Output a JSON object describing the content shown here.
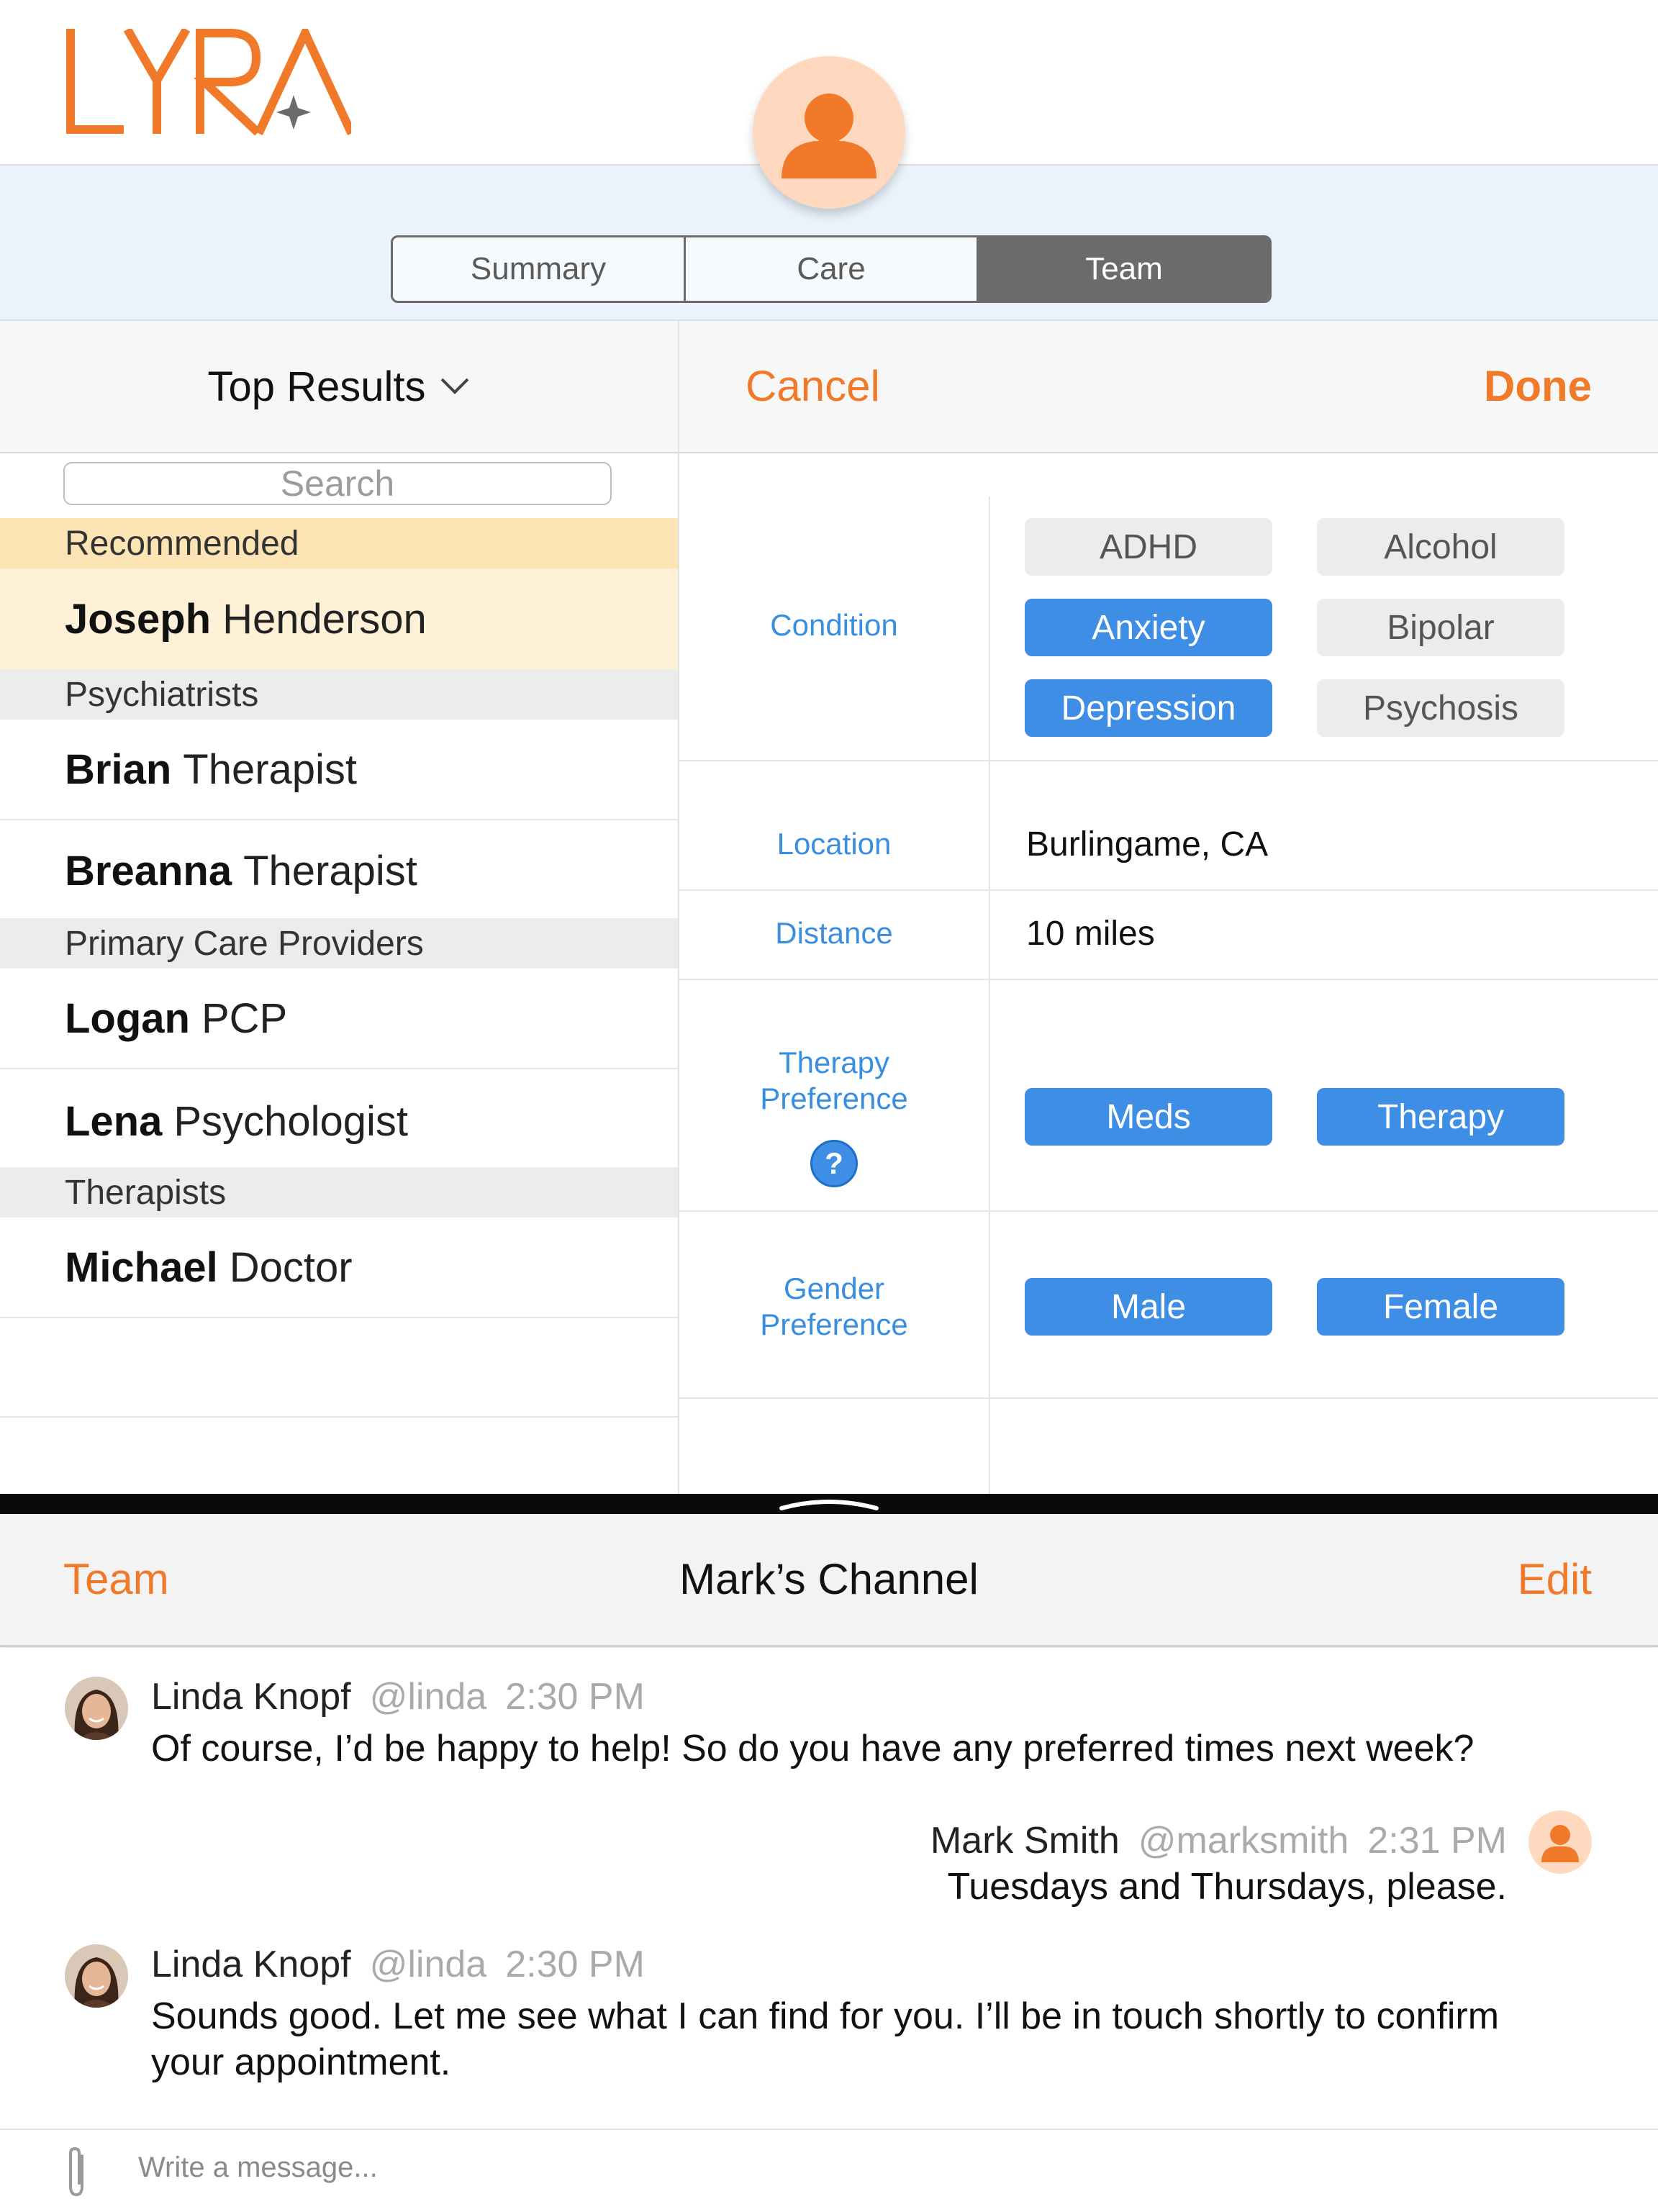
{
  "brand": {
    "logo_text": "LYRA",
    "accent_color": "#f07a2a",
    "link_color": "#3a8ee0"
  },
  "tabs": [
    {
      "label": "Summary",
      "active": false
    },
    {
      "label": "Care",
      "active": false
    },
    {
      "label": "Team",
      "active": true
    }
  ],
  "left_panel": {
    "header": "Top Results",
    "search_placeholder": "Search",
    "sections": [
      {
        "title": "Recommended",
        "items": [
          {
            "first": "Joseph",
            "last": "Henderson"
          }
        ]
      },
      {
        "title": "Psychiatrists",
        "items": [
          {
            "first": "Brian",
            "last": "Therapist"
          },
          {
            "first": "Breanna",
            "last": "Therapist"
          }
        ]
      },
      {
        "title": "Primary Care Providers",
        "items": [
          {
            "first": "Logan",
            "last": "PCP"
          },
          {
            "first": "Lena",
            "last": "Psychologist"
          }
        ]
      },
      {
        "title": "Therapists",
        "items": [
          {
            "first": "Michael",
            "last": "Doctor"
          }
        ]
      }
    ]
  },
  "right_panel": {
    "cancel": "Cancel",
    "done": "Done",
    "condition": {
      "label": "Condition",
      "chips": [
        {
          "label": "ADHD",
          "selected": false
        },
        {
          "label": "Alcohol",
          "selected": false
        },
        {
          "label": "Anxiety",
          "selected": true
        },
        {
          "label": "Bipolar",
          "selected": false
        },
        {
          "label": "Depression",
          "selected": true
        },
        {
          "label": "Psychosis",
          "selected": false
        }
      ]
    },
    "location": {
      "label": "Location",
      "value": "Burlingame, CA"
    },
    "distance": {
      "label": "Distance",
      "value": "10 miles"
    },
    "therapy_preference": {
      "label_line1": "Therapy",
      "label_line2": "Preference",
      "help": "?",
      "chips": [
        {
          "label": "Meds",
          "selected": true
        },
        {
          "label": "Therapy",
          "selected": true
        }
      ]
    },
    "gender_preference": {
      "label_line1": "Gender",
      "label_line2": "Preference",
      "chips": [
        {
          "label": "Male",
          "selected": true
        },
        {
          "label": "Female",
          "selected": true
        }
      ]
    }
  },
  "chat": {
    "back": "Team",
    "title": "Mark’s Channel",
    "edit": "Edit",
    "messages": [
      {
        "name": "Linda Knopf",
        "handle": "@linda",
        "time": "2:30 PM",
        "text": "Of course, I’d be happy to help! So do you have any preferred times next week?"
      },
      {
        "name": "Mark Smith",
        "handle": "@marksmith",
        "time": "2:31 PM",
        "text": "Tuesdays and Thursdays, please."
      },
      {
        "name": "Linda Knopf",
        "handle": "@linda",
        "time": "2:30 PM",
        "text_line1": "Sounds good. Let me see what I can find for you. I’ll be in touch shortly to confirm",
        "text_line2": "your appointment."
      }
    ],
    "composer_placeholder": "Write a message..."
  }
}
